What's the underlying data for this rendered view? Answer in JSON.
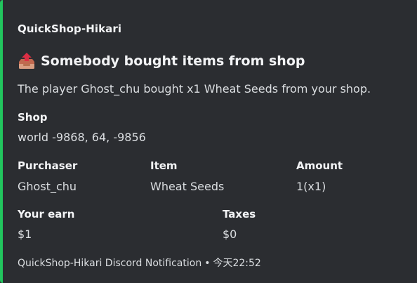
{
  "embed": {
    "accent_color": "#22c55e",
    "author": "QuickShop-Hikari",
    "title_icon": "outbox-tray-icon",
    "title": "Somebody bought items from shop",
    "description": "The player Ghost_chu bought x1 Wheat Seeds from your shop.",
    "fields": {
      "shop": {
        "name": "Shop",
        "value": "world -9868, 64, -9856"
      },
      "purchaser": {
        "name": "Purchaser",
        "value": "Ghost_chu"
      },
      "item": {
        "name": "Item",
        "value": "Wheat Seeds"
      },
      "amount": {
        "name": "Amount",
        "value": "1(x1)"
      },
      "earn": {
        "name": "Your earn",
        "value": "$1"
      },
      "taxes": {
        "name": "Taxes",
        "value": "$0"
      }
    },
    "footer": {
      "text": "QuickShop-Hikari Discord Notification",
      "separator": "•",
      "timestamp": "今天22:52"
    }
  }
}
